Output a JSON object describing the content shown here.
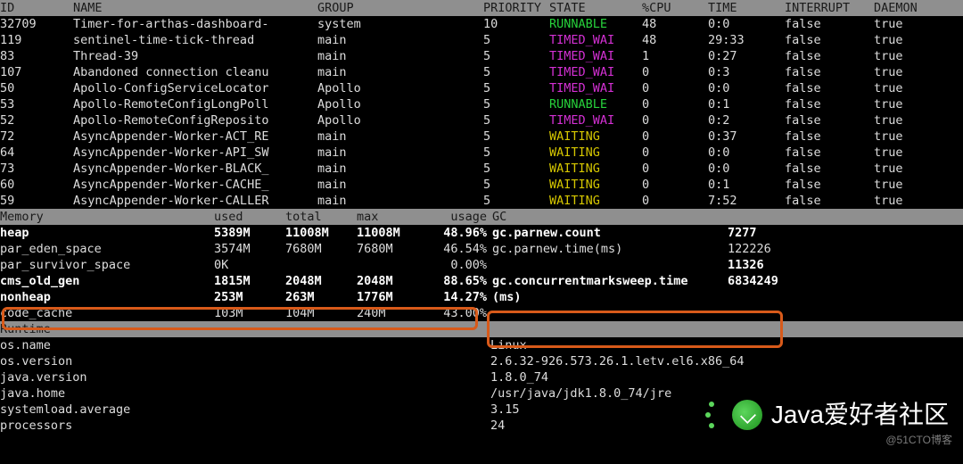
{
  "header": {
    "id": "ID",
    "name": "NAME",
    "group": "GROUP",
    "priority": "PRIORITY",
    "state": "STATE",
    "cpu": "%CPU",
    "time": "TIME",
    "interrupt": "INTERRUPT",
    "daemon": "DAEMON"
  },
  "threads": [
    {
      "id": "32709",
      "name": "Timer-for-arthas-dashboard-",
      "group": "system",
      "priority": "10",
      "state": "RUNNABLE",
      "cpu": "48",
      "time": "0:0",
      "interrupt": "false",
      "daemon": "true"
    },
    {
      "id": "119",
      "name": "sentinel-time-tick-thread",
      "group": "main",
      "priority": "5",
      "state": "TIMED_WAI",
      "cpu": "48",
      "time": "29:33",
      "interrupt": "false",
      "daemon": "true"
    },
    {
      "id": "83",
      "name": "Thread-39",
      "group": "main",
      "priority": "5",
      "state": "TIMED_WAI",
      "cpu": "1",
      "time": "0:27",
      "interrupt": "false",
      "daemon": "true"
    },
    {
      "id": "107",
      "name": "Abandoned connection cleanu",
      "group": "main",
      "priority": "5",
      "state": "TIMED_WAI",
      "cpu": "0",
      "time": "0:3",
      "interrupt": "false",
      "daemon": "true"
    },
    {
      "id": "50",
      "name": "Apollo-ConfigServiceLocator",
      "group": "Apollo",
      "priority": "5",
      "state": "TIMED_WAI",
      "cpu": "0",
      "time": "0:0",
      "interrupt": "false",
      "daemon": "true"
    },
    {
      "id": "53",
      "name": "Apollo-RemoteConfigLongPoll",
      "group": "Apollo",
      "priority": "5",
      "state": "RUNNABLE",
      "cpu": "0",
      "time": "0:1",
      "interrupt": "false",
      "daemon": "true"
    },
    {
      "id": "52",
      "name": "Apollo-RemoteConfigReposito",
      "group": "Apollo",
      "priority": "5",
      "state": "TIMED_WAI",
      "cpu": "0",
      "time": "0:2",
      "interrupt": "false",
      "daemon": "true"
    },
    {
      "id": "72",
      "name": "AsyncAppender-Worker-ACT_RE",
      "group": "main",
      "priority": "5",
      "state": "WAITING",
      "cpu": "0",
      "time": "0:37",
      "interrupt": "false",
      "daemon": "true"
    },
    {
      "id": "64",
      "name": "AsyncAppender-Worker-API_SW",
      "group": "main",
      "priority": "5",
      "state": "WAITING",
      "cpu": "0",
      "time": "0:0",
      "interrupt": "false",
      "daemon": "true"
    },
    {
      "id": "73",
      "name": "AsyncAppender-Worker-BLACK_",
      "group": "main",
      "priority": "5",
      "state": "WAITING",
      "cpu": "0",
      "time": "0:0",
      "interrupt": "false",
      "daemon": "true"
    },
    {
      "id": "60",
      "name": "AsyncAppender-Worker-CACHE_",
      "group": "main",
      "priority": "5",
      "state": "WAITING",
      "cpu": "0",
      "time": "0:1",
      "interrupt": "false",
      "daemon": "true"
    },
    {
      "id": "59",
      "name": "AsyncAppender-Worker-CALLER",
      "group": "main",
      "priority": "5",
      "state": "WAITING",
      "cpu": "0",
      "time": "7:52",
      "interrupt": "false",
      "daemon": "true"
    }
  ],
  "mem_header": {
    "label": "Memory",
    "used": "used",
    "total": "total",
    "max": "max",
    "usage": "usage",
    "gc": "GC"
  },
  "memory": [
    {
      "label": "heap",
      "bold": true,
      "used": "5389M",
      "total": "11008M",
      "max": "11008M",
      "usage": "48.96%"
    },
    {
      "label": "par_eden_space",
      "bold": false,
      "used": "3574M",
      "total": "7680M",
      "max": "7680M",
      "usage": "46.54%"
    },
    {
      "label": "par_survivor_space",
      "bold": false,
      "used": "0K",
      "total": "",
      "max": "",
      "usage": "0.00%"
    },
    {
      "label": "cms_old_gen",
      "bold": true,
      "used": "1815M",
      "total": "2048M",
      "max": "2048M",
      "usage": "88.65%"
    },
    {
      "label": "nonheap",
      "bold": true,
      "used": "253M",
      "total": "263M",
      "max": "1776M",
      "usage": "14.27%"
    },
    {
      "label": "code_cache",
      "bold": false,
      "used": "103M",
      "total": "104M",
      "max": "240M",
      "usage": "43.00%"
    }
  ],
  "gc": [
    {
      "label": "gc.parnew.count",
      "bold": true,
      "val": "7277"
    },
    {
      "label": "gc.parnew.time(ms)",
      "bold": false,
      "val": "122226"
    },
    {
      "label": "",
      "bold": false,
      "val": "11326",
      "valbold": true
    },
    {
      "label": "gc.concurrentmarksweep.time",
      "bold": true,
      "val": "6834249"
    },
    {
      "label": "(ms)",
      "bold": true,
      "val": ""
    }
  ],
  "rt_header": "Runtime",
  "runtime": [
    {
      "label": "os.name",
      "val": "Linux"
    },
    {
      "label": "os.version",
      "val": "2.6.32-926.573.26.1.letv.el6.x86_64"
    },
    {
      "label": "java.version",
      "val": "1.8.0_74"
    },
    {
      "label": "java.home",
      "val": "/usr/java/jdk1.8.0_74/jre"
    },
    {
      "label": "systemload.average",
      "val": "3.15"
    },
    {
      "label": "processors",
      "val": "24"
    }
  ],
  "watermark": "Java爱好者社区",
  "blog_tag": "@51CTO博客"
}
